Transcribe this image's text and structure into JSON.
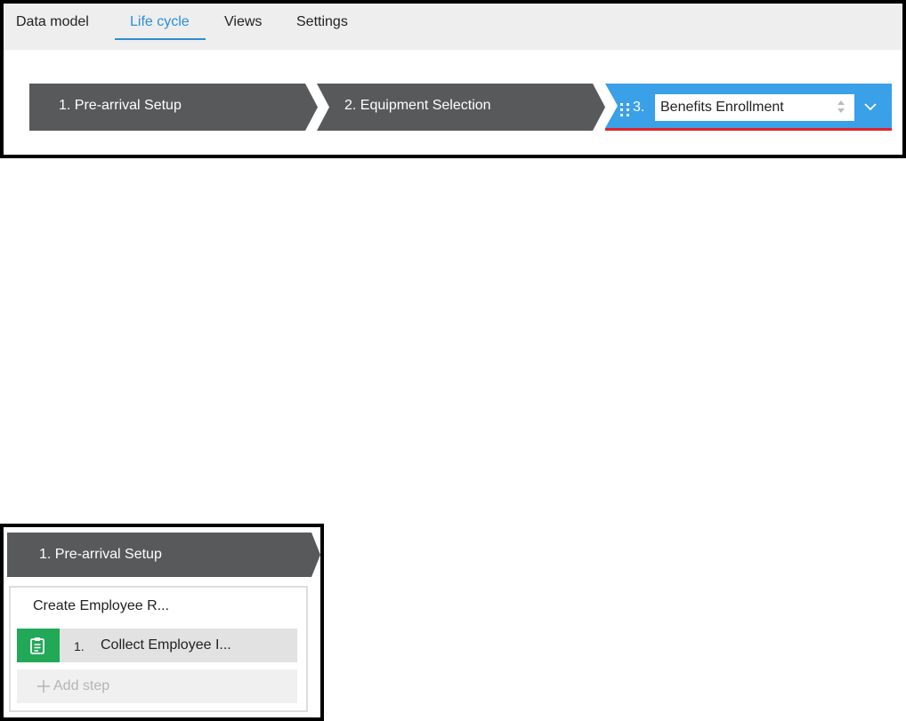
{
  "tabs": [
    {
      "label": "Data model",
      "active": false
    },
    {
      "label": "Life cycle",
      "active": true
    },
    {
      "label": "Views",
      "active": false
    },
    {
      "label": "Settings",
      "active": false
    }
  ],
  "stages": [
    {
      "label": "1.  Pre-arrival Setup"
    },
    {
      "label": "2.  Equipment Selection"
    },
    {
      "number": "3.",
      "name_value": "Benefits Enrollment"
    }
  ],
  "colors": {
    "stage_dark": "#58595b",
    "stage_active": "#3aa0e8",
    "active_tab": "#2b8fd6",
    "error_underline": "#e0242a",
    "step_icon_bg": "#21a957"
  },
  "detail": {
    "stage_label": "1.  Pre-arrival Setup",
    "process_title": "Create Employee R...",
    "step": {
      "number": "1.",
      "label": "Collect Employee I...",
      "icon": "clipboard-icon"
    },
    "add_step_label": "Add step"
  }
}
